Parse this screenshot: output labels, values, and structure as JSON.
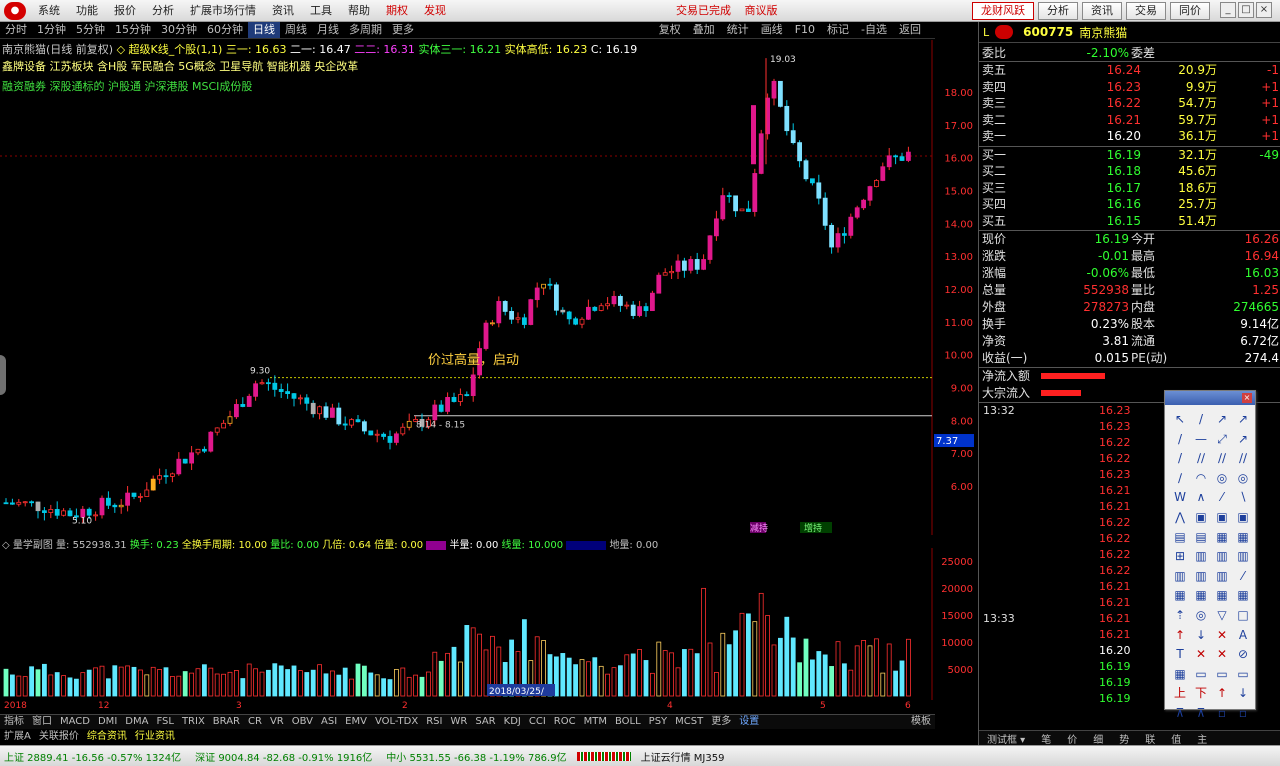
{
  "menu": {
    "items": [
      "系统",
      "功能",
      "报价",
      "分析",
      "扩展市场行情",
      "资讯",
      "工具",
      "帮助"
    ],
    "extra": [
      "期权",
      "发现"
    ],
    "center": [
      "交易已完成",
      "商议版"
    ],
    "right_buttons": [
      "龙财风跃",
      "分析",
      "资讯",
      "交易",
      "同价"
    ]
  },
  "periods": [
    "分时",
    "1分钟",
    "5分钟",
    "15分钟",
    "30分钟",
    "60分钟",
    "日线",
    "周线",
    "月线",
    "多周期",
    "更多"
  ],
  "active_period": "日线",
  "chart_tools": [
    "复权",
    "叠加",
    "统计",
    "画线",
    "F10",
    "标记",
    "-自选",
    "返回"
  ],
  "header": {
    "line1_stock": "南京熊猫(日线 前复权)",
    "line1_ma": "◇ 超级K线_个股(1,1) 三一: 16.63",
    "line1_a": "二一: 16.47",
    "line1_b": "二二: 16.31",
    "line1_c": "实体三一: 16.21",
    "line1_d": "实体高低: 16.23",
    "line1_e": "C: 16.19",
    "line2": "鑫牌设备 江苏板块 含H股 军民融合 5G概念 卫星导航 智能机器 央企改革",
    "line3": "融资融券 深股通标的 沪股通 沪深港股 MSCI成份股"
  },
  "annotations": {
    "high_label": "19.03",
    "mid_high": "9.30",
    "low_label": "5.10",
    "breakout": "价过高量，启动",
    "range_label": "8.14 - 8.15",
    "tag1": "减持",
    "tag2": "增持"
  },
  "price_axis": [
    "18.00",
    "17.00",
    "16.00",
    "15.00",
    "14.00",
    "13.00",
    "12.00",
    "11.00",
    "10.00",
    "9.00",
    "8.00",
    "7.00",
    "6.00"
  ],
  "price_axis_flag": "7.37",
  "volume_axis": [
    "25000",
    "20000",
    "15000",
    "10000",
    "5000"
  ],
  "volume_header": {
    "title": "◇ 量学副图 量: 552938.31",
    "turnover": "换手: 0.23",
    "all_turnover": "全换手周期: 10.00",
    "vol_ratio": "量比: 0.00",
    "days": "几倍: 0.64",
    "times": "倍量: 0.00",
    "half": "半量: 0.00",
    "line": "线量: 10.000",
    "zero": "地量: 0.00"
  },
  "date_label": "2018/03/25/",
  "x_labels": [
    "2018",
    "12",
    "3",
    "2",
    "4",
    "5",
    "6"
  ],
  "indicator_tabs": [
    "指标",
    "窗口",
    "MACD",
    "DMI",
    "DMA",
    "FSL",
    "TRIX",
    "BRAR",
    "CR",
    "VR",
    "OBV",
    "ASI",
    "EMV",
    "VOL-TDX",
    "RSI",
    "WR",
    "SAR",
    "KDJ",
    "CCI",
    "ROC",
    "MTM",
    "BOLL",
    "PSY",
    "MCST",
    "更多",
    "设置"
  ],
  "indicator_right": [
    "模板",
    "▸"
  ],
  "info_tabs": [
    "扩展A",
    "关联报价",
    "综合资讯",
    "行业资讯"
  ],
  "quote": {
    "tag": "L",
    "code": "600775",
    "name": "南京熊猫",
    "webi_label": "委比",
    "webi_value": "-2.10%",
    "weicha_label": "委差",
    "weicha_value": "-",
    "sell": [
      {
        "label": "卖五",
        "price": "16.24",
        "vol": "20.9万",
        "chg": "-1"
      },
      {
        "label": "卖四",
        "price": "16.23",
        "vol": "9.9万",
        "chg": "+1"
      },
      {
        "label": "卖三",
        "price": "16.22",
        "vol": "54.7万",
        "chg": "+1"
      },
      {
        "label": "卖二",
        "price": "16.21",
        "vol": "59.7万",
        "chg": "+1"
      },
      {
        "label": "卖一",
        "price": "16.20",
        "vol": "36.1万",
        "chg": "+1"
      }
    ],
    "buy": [
      {
        "label": "买一",
        "price": "16.19",
        "vol": "32.1万",
        "chg": "-49"
      },
      {
        "label": "买二",
        "price": "16.18",
        "vol": "45.6万",
        "chg": ""
      },
      {
        "label": "买三",
        "price": "16.17",
        "vol": "18.6万",
        "chg": ""
      },
      {
        "label": "买四",
        "price": "16.16",
        "vol": "25.7万",
        "chg": ""
      },
      {
        "label": "买五",
        "price": "16.15",
        "vol": "51.4万",
        "chg": ""
      }
    ],
    "fields": [
      {
        "l1": "现价",
        "v1": "16.19",
        "c1": "gr",
        "l2": "今开",
        "v2": "16.26",
        "c2": "r"
      },
      {
        "l1": "涨跌",
        "v1": "-0.01",
        "c1": "gr",
        "l2": "最高",
        "v2": "16.94",
        "c2": "r"
      },
      {
        "l1": "涨幅",
        "v1": "-0.06%",
        "c1": "gr",
        "l2": "最低",
        "v2": "16.03",
        "c2": "gr"
      },
      {
        "l1": "总量",
        "v1": "552938",
        "c1": "r",
        "l2": "量比",
        "v2": "1.25",
        "c2": "r"
      },
      {
        "l1": "外盘",
        "v1": "278273",
        "c1": "r",
        "l2": "内盘",
        "v2": "274665",
        "c2": "gr"
      },
      {
        "l1": "换手",
        "v1": "0.23%",
        "c1": "wh",
        "l2": "股本",
        "v2": "9.14亿",
        "c2": "wh"
      },
      {
        "l1": "净资",
        "v1": "3.81",
        "c1": "wh",
        "l2": "流通",
        "v2": "6.72亿",
        "c2": "wh"
      },
      {
        "l1": "收益(一)",
        "v1": "0.015",
        "c1": "wh",
        "l2": "PE(动)",
        "v2": "274.4",
        "c2": "wh"
      }
    ],
    "net_inflow": "净流入额",
    "big_inflow": "大宗流入"
  },
  "ticks": [
    {
      "t": "13:32",
      "p": "16.23",
      "c": "r"
    },
    {
      "t": "",
      "p": "16.23",
      "c": "r"
    },
    {
      "t": "",
      "p": "16.22",
      "c": "r"
    },
    {
      "t": "",
      "p": "16.22",
      "c": "r"
    },
    {
      "t": "",
      "p": "16.23",
      "c": "r"
    },
    {
      "t": "",
      "p": "16.21",
      "c": "r"
    },
    {
      "t": "",
      "p": "16.21",
      "c": "r"
    },
    {
      "t": "",
      "p": "16.22",
      "c": "r"
    },
    {
      "t": "",
      "p": "16.22",
      "c": "r"
    },
    {
      "t": "",
      "p": "16.22",
      "c": "r"
    },
    {
      "t": "",
      "p": "16.22",
      "c": "r"
    },
    {
      "t": "",
      "p": "16.21",
      "c": "r"
    },
    {
      "t": "",
      "p": "16.21",
      "c": "r"
    },
    {
      "t": "13:33",
      "p": "16.21",
      "c": "r"
    },
    {
      "t": "",
      "p": "16.21",
      "c": "r"
    },
    {
      "t": "",
      "p": "16.20",
      "c": "wh"
    },
    {
      "t": "",
      "p": "16.19",
      "c": "gr"
    },
    {
      "t": "",
      "p": "16.19",
      "c": "gr"
    },
    {
      "t": "",
      "p": "16.19",
      "c": "gr"
    }
  ],
  "right_tabs": [
    "测试框 ▾",
    "笔",
    "价",
    "细",
    "势",
    "联",
    "值",
    "主"
  ],
  "status": {
    "sh": "上证 2889.41 -16.56 -0.57% 1324亿",
    "sz": "深证 9004.84 -82.68 -0.91% 1916亿",
    "zx": "中小 5531.55 -66.38 -1.19% 786.9亿",
    "cloud": "上证云行情 MJ359"
  },
  "palette_tools": [
    "↖",
    "/",
    "↗",
    "↗",
    "/",
    "—",
    "⤢",
    "↗",
    "/",
    "∕∕",
    "∕∕",
    "∕∕",
    "∕",
    "◠",
    "◎",
    "◎",
    "W",
    "∧",
    "⁄",
    "∖",
    "⋀",
    "▣",
    "▣",
    "▣",
    "▤",
    "▤",
    "▦",
    "▦",
    "⊞",
    "▥",
    "▥",
    "▥",
    "▥",
    "▥",
    "▥",
    "⁄",
    "▦",
    "▦",
    "▦",
    "▦",
    "⇡",
    "◎",
    "▽",
    "□",
    "↑",
    "↓",
    "✕",
    "A",
    "T",
    "✕",
    "✕",
    "⊘",
    "▦",
    "▭",
    "▭",
    "▭",
    "上",
    "下",
    "↑",
    "↓",
    "⊼",
    "⊼",
    "▫",
    "▫"
  ],
  "colors": {
    "up": "#ff3030",
    "down": "#00e6ff",
    "up_candle": "#e0188c",
    "grid": "#8b0000",
    "bg": "#000000"
  }
}
